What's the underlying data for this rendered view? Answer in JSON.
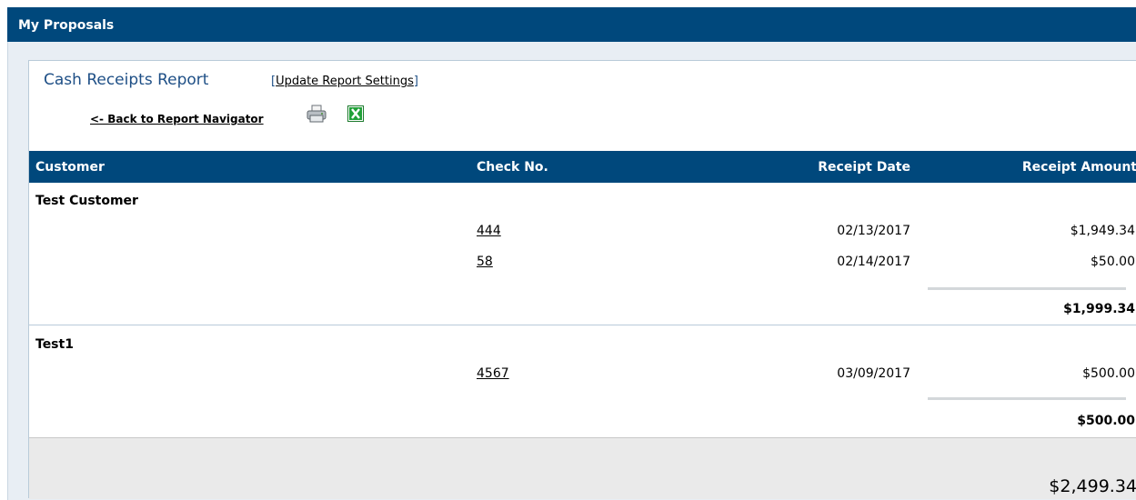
{
  "header": {
    "title": "My Proposals"
  },
  "report": {
    "title": "Cash Receipts Report",
    "settings_link": "Update Report Settings",
    "settings_open": "[",
    "settings_close": "]",
    "back_link": "<- Back to Report Navigator"
  },
  "table": {
    "columns": [
      "Customer",
      "Check No.",
      "Receipt Date",
      "Receipt Amount"
    ],
    "groups": [
      {
        "customer": "Test Customer",
        "rows": [
          {
            "check": "444",
            "date": "02/13/2017",
            "amount": "$1,949.34"
          },
          {
            "check": "58",
            "date": "02/14/2017",
            "amount": "$50.00"
          }
        ],
        "subtotal": "$1,999.34"
      },
      {
        "customer": "Test1",
        "rows": [
          {
            "check": "4567",
            "date": "03/09/2017",
            "amount": "$500.00"
          }
        ],
        "subtotal": "$500.00"
      }
    ],
    "grand_total": "$2,499.34"
  },
  "icons": {
    "print": "printer-icon",
    "excel": "excel-icon"
  },
  "colors": {
    "header_bg": "#00487c",
    "title": "#1e4f86",
    "total_bg": "#eaeaea"
  }
}
